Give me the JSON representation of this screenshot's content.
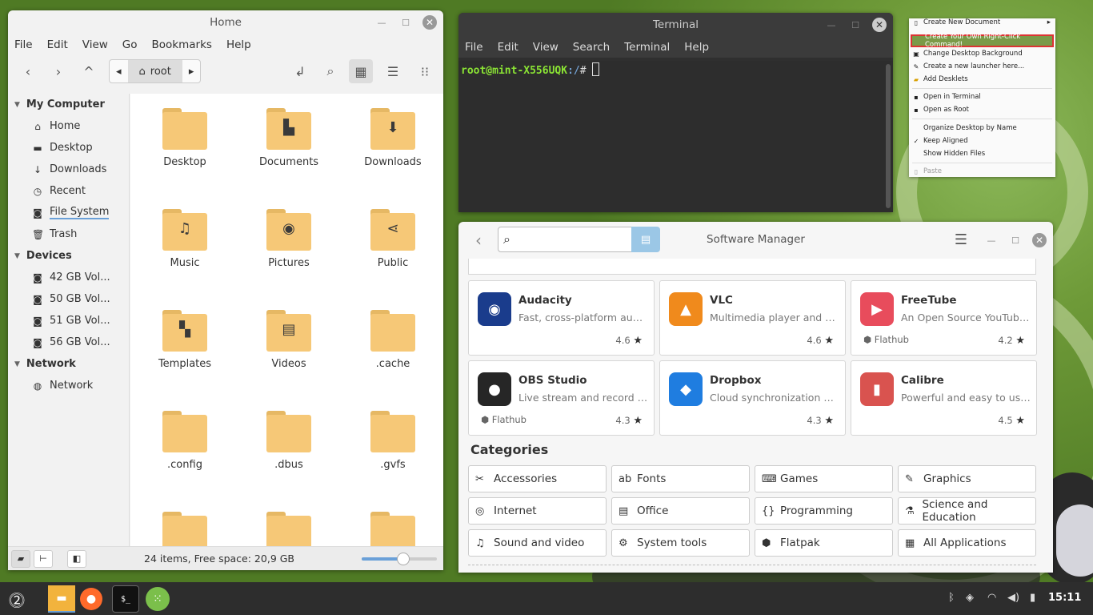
{
  "file_manager": {
    "title": "Home",
    "menu": [
      "File",
      "Edit",
      "View",
      "Go",
      "Bookmarks",
      "Help"
    ],
    "breadcrumb": "root",
    "sidebar": {
      "my_computer": "My Computer",
      "places": [
        "Home",
        "Desktop",
        "Downloads",
        "Recent",
        "File System",
        "Trash"
      ],
      "devices_header": "Devices",
      "devices": [
        "42 GB Vol...",
        "50 GB Vol...",
        "51 GB Vol...",
        "56 GB Vol..."
      ],
      "network_header": "Network",
      "network": [
        "Network"
      ]
    },
    "folders": [
      "Desktop",
      "Documents",
      "Downloads",
      "Music",
      "Pictures",
      "Public",
      "Templates",
      "Videos",
      ".cache",
      ".config",
      ".dbus",
      ".gvfs"
    ],
    "status": "24 items, Free space: 20,9 GB",
    "zoom_level": 0.55
  },
  "terminal": {
    "title": "Terminal",
    "menu": [
      "File",
      "Edit",
      "View",
      "Search",
      "Terminal",
      "Help"
    ],
    "prompt_user": "root@mint-X556UQK",
    "prompt_path": ":/",
    "prompt_symbol": "# "
  },
  "context_menu": {
    "items": [
      "Create New Document",
      "Create Your Own Right-Click Command!",
      "Change Desktop Background",
      "Create a new launcher here...",
      "Add Desklets",
      "Open in Terminal",
      "Open as Root",
      "Organize Desktop by Name",
      "Keep Aligned",
      "Show Hidden Files",
      "Paste"
    ]
  },
  "software_manager": {
    "title": "Software Manager",
    "search_placeholder": "",
    "apps": [
      {
        "name": "Audacity",
        "desc": "Fast, cross-platform audio editor",
        "rating": "4.6",
        "source": "",
        "color": "#1a3c8c"
      },
      {
        "name": "VLC",
        "desc": "Multimedia player and streamer",
        "rating": "4.6",
        "source": "",
        "color": "#f08a1c"
      },
      {
        "name": "FreeTube",
        "desc": "An Open Source YouTube app",
        "rating": "4.2",
        "source": "Flathub",
        "color": "#e84c5c"
      },
      {
        "name": "OBS Studio",
        "desc": "Live stream and record videos",
        "rating": "4.3",
        "source": "Flathub",
        "color": "#262626"
      },
      {
        "name": "Dropbox",
        "desc": "Cloud synchronization engine",
        "rating": "4.3",
        "source": "",
        "color": "#1f7de0"
      },
      {
        "name": "Calibre",
        "desc": "Powerful and easy to use e-book manager",
        "rating": "4.5",
        "source": "",
        "color": "#d9534f"
      }
    ],
    "categories_title": "Categories",
    "categories": [
      "Accessories",
      "Fonts",
      "Games",
      "Graphics",
      "Internet",
      "Office",
      "Programming",
      "Science and Education",
      "Sound and video",
      "System tools",
      "Flatpak",
      "All Applications"
    ]
  },
  "taskbar": {
    "clock": "15:11"
  }
}
